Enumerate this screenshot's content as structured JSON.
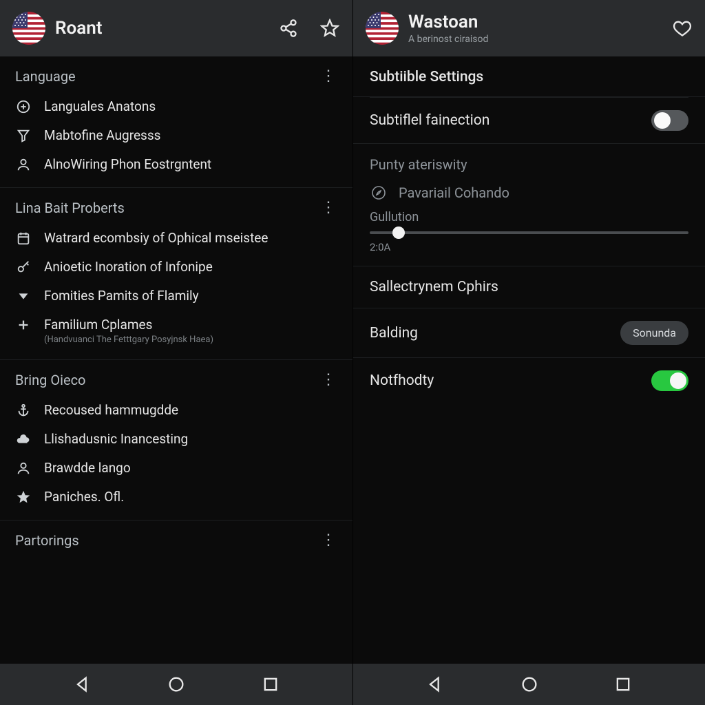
{
  "left": {
    "header": {
      "title": "Roant"
    },
    "sections": [
      {
        "title": "Language",
        "items": [
          {
            "icon": "plus-circle-icon",
            "label": "Languales Anatons"
          },
          {
            "icon": "filter-icon",
            "label": "Mabtofine Augresss"
          },
          {
            "icon": "person-icon",
            "label": "AlnoWiring Phon Eostrgntent"
          }
        ]
      },
      {
        "title": "Lina Bait Proberts",
        "items": [
          {
            "icon": "calendar-icon",
            "label": "Watrard ecombsiy of Ophical mseistee"
          },
          {
            "icon": "key-icon",
            "label": "Anioetic Inoration of Infonipe"
          },
          {
            "icon": "arrow-down-icon",
            "label": "Fomities Pamits of Flamily"
          },
          {
            "icon": "plus-icon",
            "label": "Familium Cplames",
            "sub": "(Handvuanci The Fetttgary Posyjnsk Haea)"
          }
        ]
      },
      {
        "title": "Bring Oieco",
        "items": [
          {
            "icon": "anchor-icon",
            "label": "Recoused hammugdde"
          },
          {
            "icon": "cloud-icon",
            "label": "Llishadusnic Inancesting"
          },
          {
            "icon": "person-icon",
            "label": "Brawdde lango"
          },
          {
            "icon": "star-icon",
            "label": "Paniches. Ofl."
          }
        ]
      },
      {
        "title": "Partorings",
        "items": []
      }
    ]
  },
  "right": {
    "header": {
      "title": "Wastoan",
      "subtitle": "A berinost ciraisod"
    },
    "subtitle_settings": "Subtiible Settings",
    "toggle1": {
      "label": "Subtiflel fainection",
      "on": false
    },
    "punty_heading": "Punty ateriswity",
    "punty_item": {
      "label": "Pavariail Cohando"
    },
    "slider": {
      "label": "Gullution",
      "value_text": "2:0A",
      "percent": 9
    },
    "sallect_heading": "Sallectrynem Cphirs",
    "balding": {
      "label": "Balding",
      "chip": "Sonunda"
    },
    "toggle2": {
      "label": "Notfhodty",
      "on": true
    }
  }
}
